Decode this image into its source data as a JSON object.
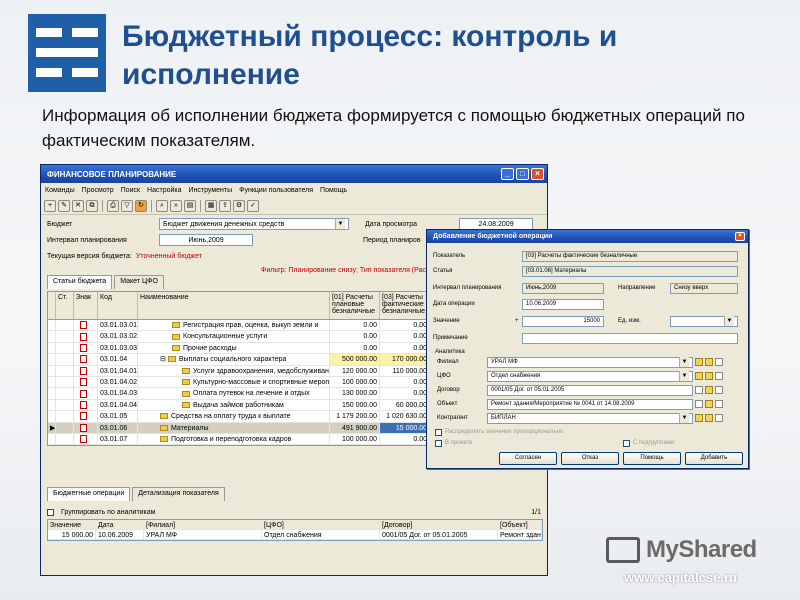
{
  "slide": {
    "title": "Бюджетный процесс: контроль и исполнение",
    "subtitle": "Информация об исполнении бюджета формируется с помощью бюджетных операций по фактическим показателям.",
    "accent_color": "#1f5fa8",
    "watermark_brand": "MyShared",
    "watermark_site": "www.capitalcse.ru"
  },
  "main_window": {
    "title": "ФИНАНСОВОЕ ПЛАНИРОВАНИЕ",
    "menu": [
      "Команды",
      "Просмотр",
      "Поиск",
      "Настройка",
      "Инструменты",
      "Функции пользователя",
      "Помощь"
    ],
    "budget_label": "Бюджет",
    "budget_value": "Бюджет движения денежных средств",
    "view_date_label": "Дата просмотра",
    "view_date_value": "24.08.2009",
    "interval_label": "Интервал планирования",
    "interval_value": "Июнь,2009",
    "period_label": "Период планиров",
    "current_version_label": "Текущая версия бюджета:",
    "current_version_value": "Уточненный бюджет",
    "filter_text": "Фильтр: Планирование снизу; Тип показателя (Расход)",
    "tabs": [
      "Статьи бюджета",
      "Макет ЦФО"
    ],
    "grid_headers": {
      "col_st": "Ст.",
      "col_sign": "Знак",
      "col_code": "Код",
      "col_name": "Наименование",
      "col_plan": "[01] Расчеты плановые безналичные",
      "col_fact": "[03] Расчеты фактические безналичные"
    },
    "rows": [
      {
        "code": "03.01.03.01",
        "name": "Регистрация прав, оценка, выкуп земли и",
        "plan": "0.00",
        "fact": "0.00"
      },
      {
        "code": "03.01.03.02",
        "name": "Консультационные услуги",
        "plan": "0.00",
        "fact": "0.00"
      },
      {
        "code": "03.01.03.03",
        "name": "Прочие расходы",
        "plan": "0.00",
        "fact": "0.00"
      },
      {
        "code": "03.01.04",
        "name": "Выплаты социального характера",
        "plan": "500 000.00",
        "fact": "170 000.00"
      },
      {
        "code": "03.01.04.01",
        "name": "Услуги здравоохранения, медобслуживан",
        "plan": "120 000.00",
        "fact": "110 000.00"
      },
      {
        "code": "03.01.04.02",
        "name": "Культурно-массовые и спортивные мероп",
        "plan": "100 000.00",
        "fact": "0.00"
      },
      {
        "code": "03.01.04.03",
        "name": "Оплата путевок на лечение и отдых",
        "plan": "130 000.00",
        "fact": "0.00"
      },
      {
        "code": "03.01.04.04",
        "name": "Выдача займов работникам",
        "plan": "150 000.00",
        "fact": "60 000.00"
      },
      {
        "code": "03.01.05",
        "name": "Средства на оплату труда к выплате",
        "plan": "1 179 200.00",
        "fact": "1 020 630.00"
      },
      {
        "code": "03.01.06",
        "name": "Материалы",
        "plan": "491 900.00",
        "fact": "15 000.00"
      },
      {
        "code": "03.01.07",
        "name": "Подготовка и переподготовка кадров",
        "plan": "100 000.00",
        "fact": "0.00"
      }
    ],
    "bottom_tabs": [
      "Бюджетные операции",
      "Детализация показателя"
    ],
    "group_checkbox_label": "Группировать по аналитикам",
    "page_indicator": "1/1",
    "ops_headers": [
      "Значение",
      "Дата",
      "[Филиал]",
      "[ЦФО]",
      "[Договор]",
      "[Объект]"
    ],
    "ops_row": [
      "15 000.00",
      "10.06.2009",
      "УРАЛ МФ",
      "Отдел снабжения",
      "0001/05 Дог. от 05.01.2005",
      "Ремонт здания"
    ]
  },
  "dialog": {
    "title": "Добавление бюджетной операции",
    "indicator_label": "Показатель",
    "indicator_value": "[03] Расчеты фактические безналичные",
    "article_label": "Статья",
    "article_value": "[03.01.06] Материалы",
    "interval_label": "Интервал планирования",
    "interval_value": "Июнь,2009",
    "direction_label": "Направление",
    "direction_value": "Снизу вверх",
    "op_date_label": "Дата операции",
    "op_date_value": "10.06.2009",
    "value_label": "Значение",
    "value_sign": "+",
    "value_value": "15000",
    "unit_label": "Ед. изм.",
    "note_label": "Примечание",
    "analytics_label": "Аналитика",
    "analytics": [
      {
        "label": "Филиал",
        "value": "УРАЛ МФ"
      },
      {
        "label": "ЦФО",
        "value": "Отдел снабжения"
      },
      {
        "label": "Договор",
        "value": "0001/05 Дог. от 05.01.2005"
      },
      {
        "label": "Объект",
        "value": "Ремонт здания/Мероприятие № 0041 от 14.08.2009"
      },
      {
        "label": "Контрагент",
        "value": "БИПЛАН"
      }
    ],
    "distribute_label": "Распределить значение пропорционально",
    "in_project_label": "В проекте",
    "with_subgroups_label": "С подгруппами",
    "buttons": {
      "agree": "Согласен",
      "cancel": "Отказ",
      "help": "Помощь",
      "add": "Добавить"
    }
  }
}
